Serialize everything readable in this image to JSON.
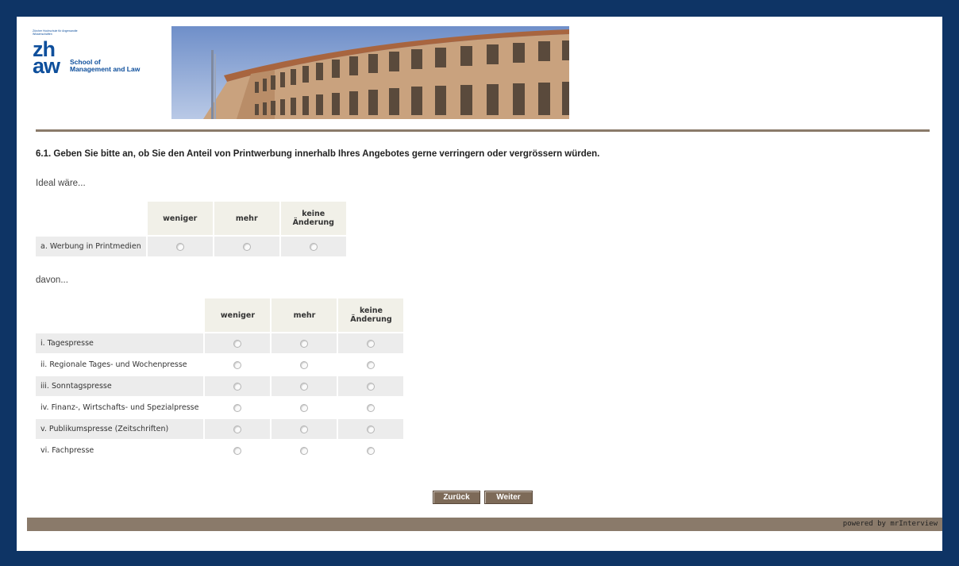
{
  "logo": {
    "small_text": "Zürcher Hochschule für Angewandte Wissenschaften",
    "zh": "zh",
    "aw": "aw",
    "school_line1": "School of",
    "school_line2": "Management and Law"
  },
  "question": "6.1. Geben Sie bitte an, ob Sie den Anteil von Printwerbung innerhalb Ihres Angebotes gerne verringern oder vergrössern würden.",
  "intro1": "Ideal wäre...",
  "intro2": "davon...",
  "columns": [
    "weniger",
    "mehr",
    "keine Änderung"
  ],
  "table1": {
    "rows": [
      "a. Werbung in Printmedien"
    ]
  },
  "table2": {
    "rows": [
      "i. Tagespresse",
      "ii. Regionale Tages- und Wochenpresse",
      "iii. Sonntagspresse",
      "iv. Finanz-, Wirtschafts- und Spezialpresse",
      "v. Publikumspresse (Zeitschriften)",
      "vi. Fachpresse"
    ]
  },
  "buttons": {
    "back": "Zurück",
    "next": "Weiter"
  },
  "footer": "powered by mrInterview",
  "colors": {
    "border": "#0e3465",
    "accent": "#8a7a6a",
    "brand_blue": "#0e4f9c",
    "button": "#7d6a58"
  }
}
